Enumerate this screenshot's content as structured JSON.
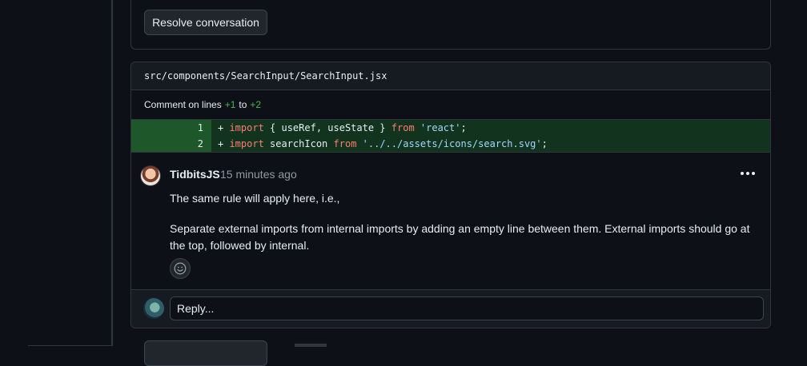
{
  "resolve_button": "Resolve conversation",
  "file": {
    "path": "src/components/SearchInput/SearchInput.jsx",
    "comment_on": "Comment on lines",
    "line_start": "+1",
    "to": "to",
    "line_end": "+2"
  },
  "diff": [
    {
      "num": "1",
      "plus": "+ ",
      "kw1": "import",
      "mid": " { useRef, useState } ",
      "kw2": "from",
      "sp": " ",
      "str": "'react'",
      "end": ";"
    },
    {
      "num": "2",
      "plus": "+ ",
      "kw1": "import",
      "mid": " searchIcon ",
      "kw2": "from",
      "sp": " ",
      "str": "'../../assets/icons/search.svg'",
      "end": ";"
    }
  ],
  "comment": {
    "author": "TidbitsJS",
    "time": "15 minutes ago",
    "p1": "The same rule will apply here, i.e.,",
    "p2": "Separate external imports from internal imports by adding an empty line between them. External imports should go at the top, followed by internal."
  },
  "reply": {
    "placeholder": "Reply..."
  },
  "icons": {
    "more": "kebab-horizontal-icon",
    "emoji": "smiley-icon"
  },
  "colors": {
    "addition": "#3fb950",
    "diff_bg": "#12341f",
    "diff_num_bg": "#1d572a",
    "keyword": "#ff7b72",
    "string": "#a5d6ff"
  }
}
